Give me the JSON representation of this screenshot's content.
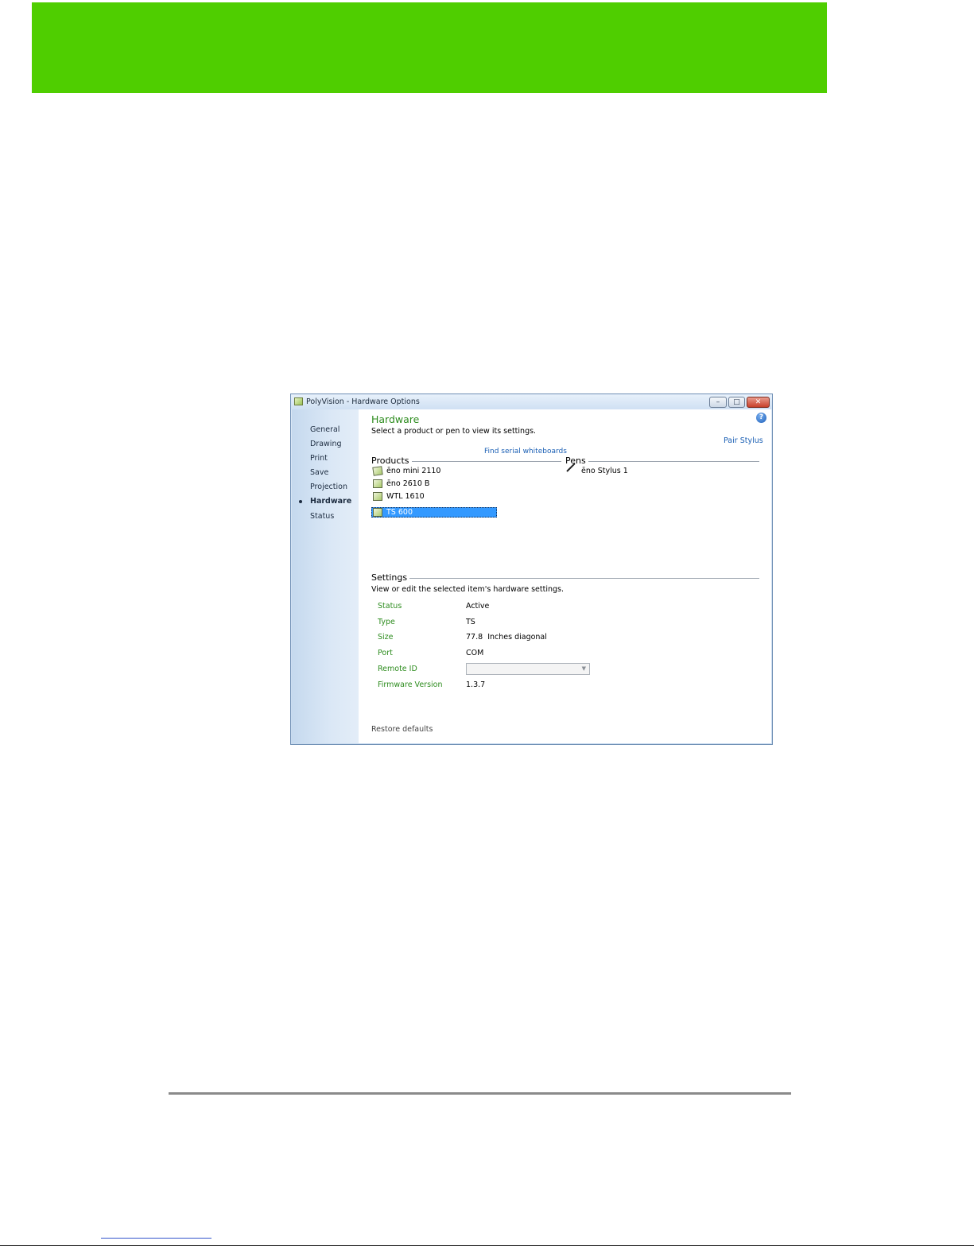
{
  "window": {
    "title": "PolyVision - Hardware Options",
    "controls": {
      "minimize": "–",
      "maximize": "□",
      "close": "✕"
    }
  },
  "sidebar": {
    "items": [
      {
        "label": "General"
      },
      {
        "label": "Drawing"
      },
      {
        "label": "Print"
      },
      {
        "label": "Save"
      },
      {
        "label": "Projection"
      },
      {
        "label": "Hardware",
        "active": true
      },
      {
        "label": "Status"
      }
    ]
  },
  "hardware": {
    "title": "Hardware",
    "subtitle": "Select a product or pen to view its settings.",
    "help_icon": "?",
    "pair_stylus": "Pair Stylus",
    "find_serial": "Find serial whiteboards",
    "products_label": "Products",
    "pens_label": "Pens",
    "products": [
      "ēno mini 2110",
      "ēno 2610 B",
      "WTL 1610",
      "TS 600"
    ],
    "selected_product": "TS 600",
    "pens": [
      "ēno Stylus 1"
    ]
  },
  "settings": {
    "title": "Settings",
    "subtitle": "View or edit the selected item's hardware settings.",
    "rows": [
      {
        "label": "Status",
        "value": "Active"
      },
      {
        "label": "Type",
        "value": "TS"
      },
      {
        "label": "Size",
        "value": "77.8  Inches diagonal"
      },
      {
        "label": "Port",
        "value": "COM"
      },
      {
        "label": "Remote ID",
        "value": ""
      },
      {
        "label": "Firmware Version",
        "value": "1.3.7"
      }
    ],
    "restore_defaults": "Restore defaults"
  },
  "colors": {
    "banner": "#4fce00",
    "accent_green": "#2d8c1e",
    "link_blue": "#1a5fb4",
    "selection": "#3399ff"
  }
}
